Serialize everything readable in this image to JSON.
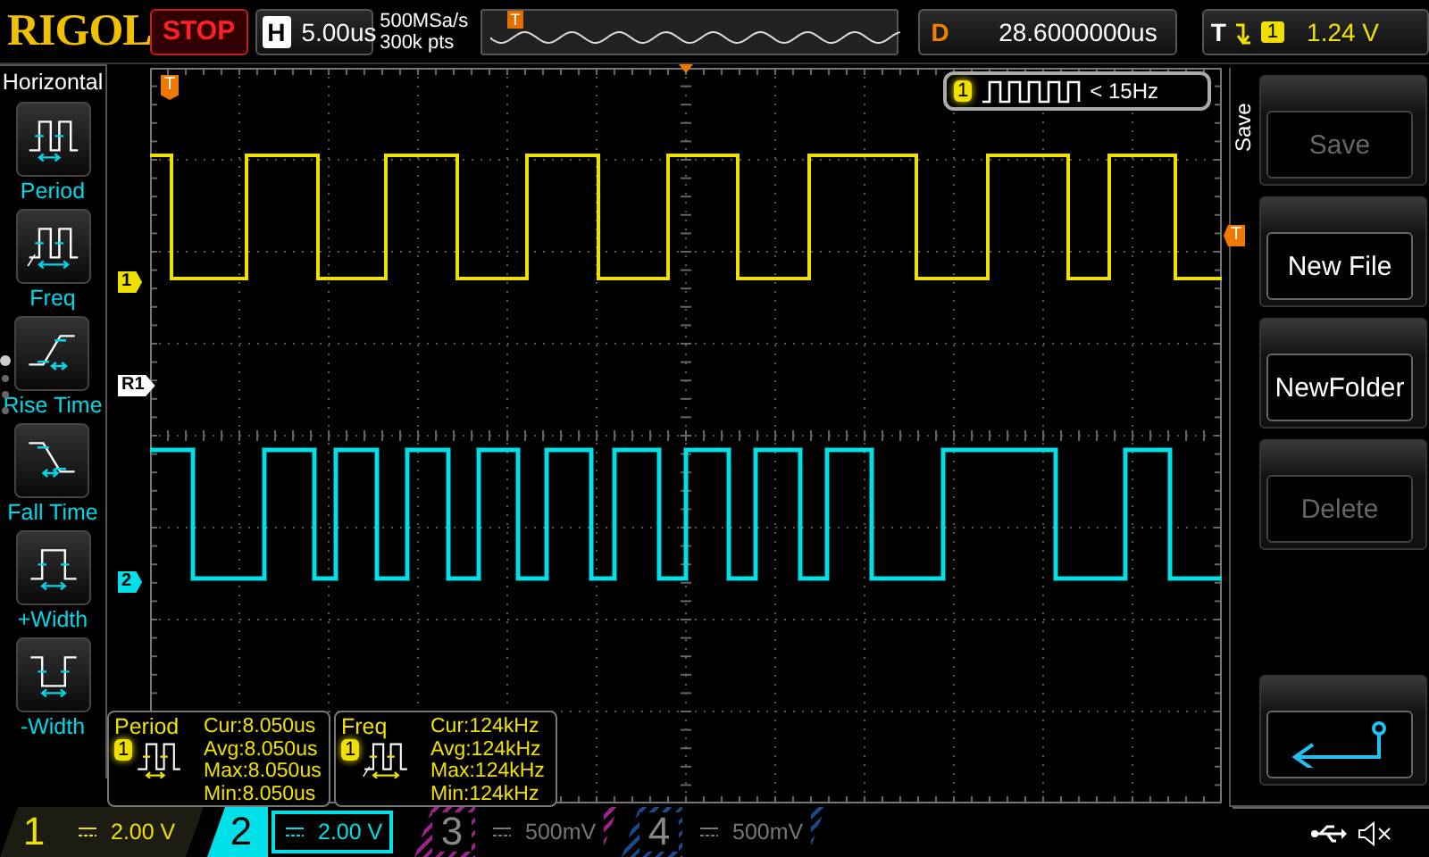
{
  "top_bar": {
    "logo": "RIGOL",
    "run_state": "STOP",
    "timebase": {
      "label": "H",
      "value": "5.00us"
    },
    "sample_rate": "500MSa/s",
    "memory_depth": "300k pts",
    "overview_marker": "T",
    "delay": {
      "label": "D",
      "value": "28.6000000us"
    },
    "trigger": {
      "label": "T",
      "source": "1",
      "level": "1.24 V"
    }
  },
  "left_menu": {
    "title": "Horizontal",
    "pages": [
      {
        "selected": true
      },
      {
        "selected": false
      },
      {
        "selected": false
      },
      {
        "selected": false
      }
    ],
    "items": [
      {
        "label": "Period",
        "kind": "period"
      },
      {
        "label": "Freq",
        "kind": "freq"
      },
      {
        "label": "Rise Time",
        "kind": "rise"
      },
      {
        "label": "Fall Time",
        "kind": "fall"
      },
      {
        "label": "+Width",
        "kind": "pwidth"
      },
      {
        "label": "-Width",
        "kind": "nwidth"
      }
    ]
  },
  "grid": {
    "markers": [
      {
        "label": "1",
        "color": "#f0e000",
        "kind": "channel"
      },
      {
        "label": "R1",
        "color": "#ffffff",
        "kind": "reference"
      },
      {
        "label": "2",
        "color": "#00e0e8",
        "kind": "channel"
      }
    ],
    "trigger_position_marker": "T",
    "trigger_level_marker": "T",
    "counter": {
      "channel": "1",
      "reading": "< 15Hz"
    }
  },
  "measurements": [
    {
      "name": "Period",
      "channel": "1",
      "kind": "period",
      "lines": [
        "Cur:8.050us",
        "Avg:8.050us",
        "Max:8.050us",
        "Min:8.050us"
      ]
    },
    {
      "name": "Freq",
      "channel": "1",
      "kind": "freq",
      "lines": [
        "Cur:124kHz",
        "Avg:124kHz",
        "Max:124kHz",
        "Min:124kHz"
      ]
    }
  ],
  "right_menu": {
    "title": "Save",
    "buttons": [
      {
        "kind": "text",
        "label": "Save",
        "disabled": true
      },
      {
        "kind": "text",
        "label": "New File",
        "disabled": false
      },
      {
        "kind": "text",
        "label": "NewFolder",
        "disabled": false
      },
      {
        "kind": "text",
        "label": "Delete",
        "disabled": true
      },
      {
        "kind": "back",
        "disabled": false
      }
    ]
  },
  "channels": [
    {
      "number": "1",
      "scale": "2.00 V",
      "color": "#f0e000",
      "enabled": true,
      "selected": false
    },
    {
      "number": "2",
      "scale": "2.00 V",
      "color": "#00e0e8",
      "enabled": true,
      "selected": true
    },
    {
      "number": "3",
      "scale": "500mV",
      "color": "#a0208a",
      "enabled": false,
      "selected": false
    },
    {
      "number": "4",
      "scale": "500mV",
      "color": "#1a4a8a",
      "enabled": false,
      "selected": false
    }
  ]
}
